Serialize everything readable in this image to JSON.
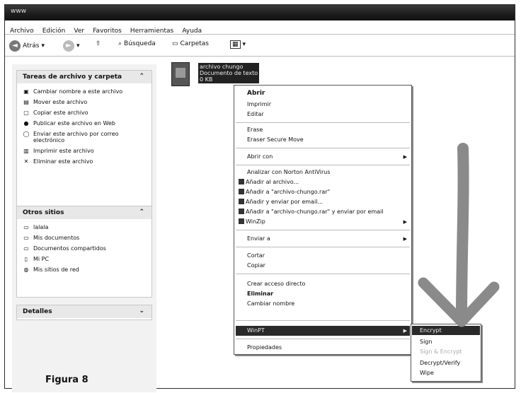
{
  "window": {
    "title": "www"
  },
  "menubar": [
    "Archivo",
    "Edición",
    "Ver",
    "Favoritos",
    "Herramientas",
    "Ayuda"
  ],
  "toolbar": {
    "back": "Atrás",
    "search": "Búsqueda",
    "folders": "Carpetas"
  },
  "file_tasks": {
    "title": "Tareas de archivo y carpeta",
    "items": [
      {
        "label": "Cambiar nombre a este archivo",
        "icon": "rename-icon"
      },
      {
        "label": "Mover este archivo",
        "icon": "move-icon"
      },
      {
        "label": "Copiar este archivo",
        "icon": "copy-icon"
      },
      {
        "label": "Publicar este archivo en Web",
        "icon": "globe-icon"
      },
      {
        "label": "Enviar este archivo por correo electrónico",
        "icon": "mail-icon"
      },
      {
        "label": "Imprimir este archivo",
        "icon": "printer-icon"
      },
      {
        "label": "Eliminar este archivo",
        "icon": "delete-icon"
      }
    ]
  },
  "other_places": {
    "title": "Otros sitios",
    "items": [
      {
        "label": "lalala",
        "icon": "folder-icon"
      },
      {
        "label": "Mis documentos",
        "icon": "folder-icon"
      },
      {
        "label": "Documentos compartidos",
        "icon": "folder-icon"
      },
      {
        "label": "Mi PC",
        "icon": "computer-icon"
      },
      {
        "label": "Mis sitios de red",
        "icon": "network-icon"
      }
    ]
  },
  "details": {
    "title": "Detalles"
  },
  "file": {
    "name": "archivo chungo",
    "type": "Documento de texto",
    "size": "0 KB"
  },
  "context_menu": {
    "open": "Abrir",
    "print": "Imprimir",
    "edit": "Editar",
    "erase": "Erase",
    "eraser_secure_move": "Eraser Secure Move",
    "open_with": "Abrir con",
    "norton": "Analizar con Norton AntiVirus",
    "add_archive": "Añadir al archivo...",
    "add_rar": "Añadir a \"archivo-chungo.rar\"",
    "add_email": "Añadir y enviar por email...",
    "add_rar_email": "Añadir a \"archivo-chungo.rar\" y enviar por email",
    "winzip": "WinZip",
    "send_to": "Enviar a",
    "cut": "Cortar",
    "copy": "Copiar",
    "shortcut": "Crear acceso directo",
    "delete": "Eliminar",
    "rename": "Cambiar nombre",
    "winpt": "WinPT",
    "properties": "Propiedades"
  },
  "winpt_submenu": {
    "encrypt": "Encrypt",
    "sign": "Sign",
    "sign_encrypt": "Sign & Encrypt",
    "decrypt_verify": "Decrypt/Verify",
    "wipe": "Wipe"
  },
  "caption": "Figura 8",
  "colors": {
    "highlight": "#2a2a2a",
    "arrow": "#8a8a8a"
  }
}
